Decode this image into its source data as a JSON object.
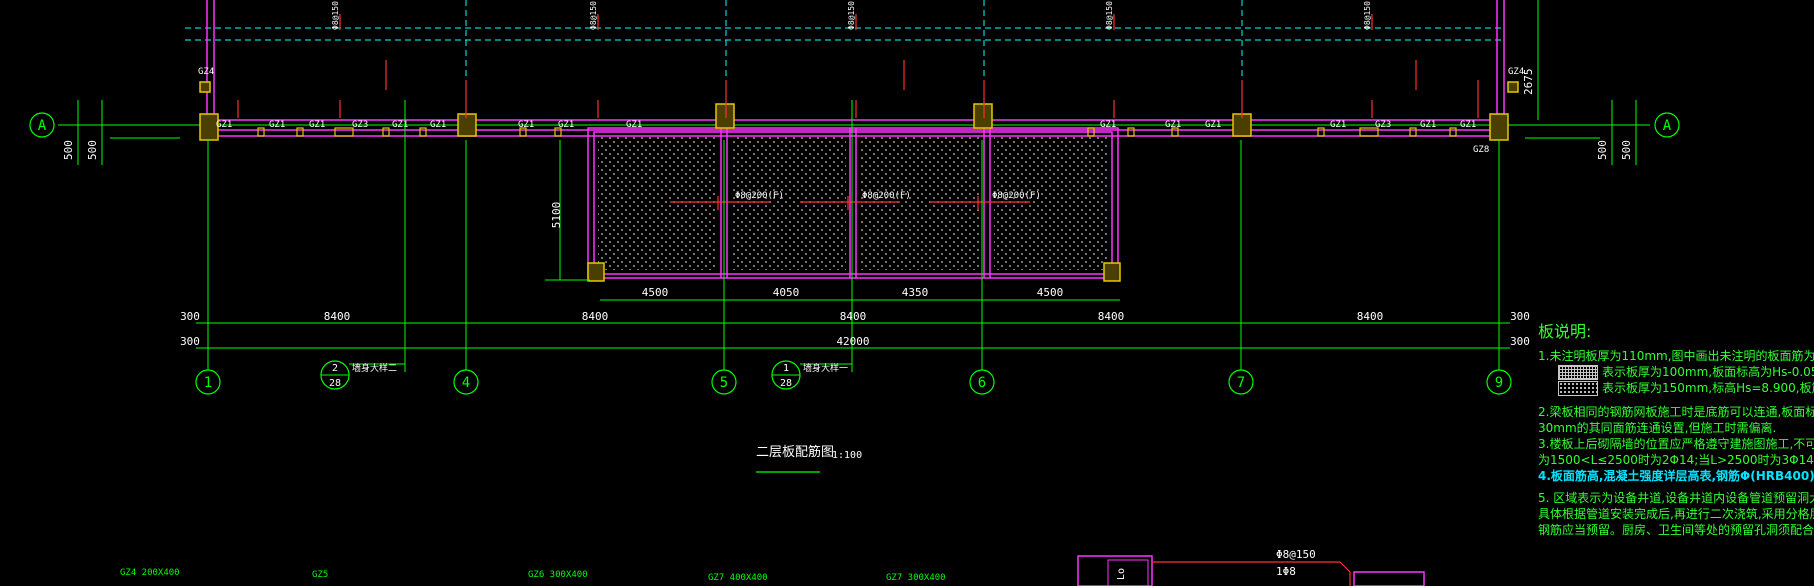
{
  "drawing": {
    "axis_row_label": "A",
    "axis_col_labels": [
      "1",
      "4",
      "5",
      "6",
      "7",
      "9"
    ],
    "bay_dims": [
      "8400",
      "8400",
      "8400",
      "8400",
      "8400"
    ],
    "total_dim": "42000",
    "edge_dims": [
      "300",
      "300"
    ],
    "side_dims": [
      "500",
      "500"
    ],
    "right_dim": "2675",
    "bottom_bay_dims": [
      "4500",
      "4050",
      "4350",
      "4500"
    ],
    "depth_dim": "5100",
    "detail_refs": [
      {
        "num": "2",
        "sheet": "28",
        "text": "墙身大样二"
      },
      {
        "num": "1",
        "sheet": "28",
        "text": "墙身大样一"
      }
    ],
    "title": "二层板配筋图",
    "scale": "1:100",
    "slab_labels": [
      "Φ8@150",
      "Φ8@200(F)"
    ],
    "column_tags": [
      "GZ4",
      "GZ1",
      "GZ2",
      "GZ3",
      "GZ8"
    ],
    "section_tags": [
      "GZ4  200X400",
      "GZ5",
      "GZ6  300X400",
      "GZ7  400X400",
      "GZ7  300X400"
    ],
    "stair_label": "Φ8@150",
    "stair_sub": "1Φ8",
    "lo_label": "Lo"
  },
  "notes": {
    "heading": "板说明:",
    "lines": [
      "1.未注明板厚为110mm,图中画出未注明的板面筋为Φ8@200,除",
      "表示板厚为100mm,板面标高为Hs-0.050,板筋",
      "表示板厚为150mm,标高Hs=8.900,板筋为Φ8",
      "2.梁板相同的钢筋网板施工时是底筋可以连通,板面标高相差不超过",
      "30mm的其同面筋连通设置,但施工时需偏离.",
      "3.楼板上后砌隔墙的位置应严格遵守建施图施工,不可随意砌筑。凡跨",
      "为1500<L≤2500时为2Φ14;当L>2500时为3Φ14,两端",
      "4.板面筋高,混凝土强度详层高表,钢筋Φ(HRB400)级。",
      "5.       区域表示为设备井道,设备井道内设备管道预留洞大小,尺",
      "具体根据管道安装完成后,再进行二次浇筑,采用分格层层相邻板的",
      "钢筋应当预留。厨房、卫生间等处的预留孔洞须配合建筑、给排水"
    ]
  },
  "colors": {
    "background": "#000000",
    "axis_green": "#00ff00",
    "dashed_cyan": "#00ffff",
    "wall_magenta": "#ff33ff",
    "column_yellow": "#e6c800",
    "rebar_red": "#ff3030",
    "hatch_white": "#c8c8c8"
  }
}
